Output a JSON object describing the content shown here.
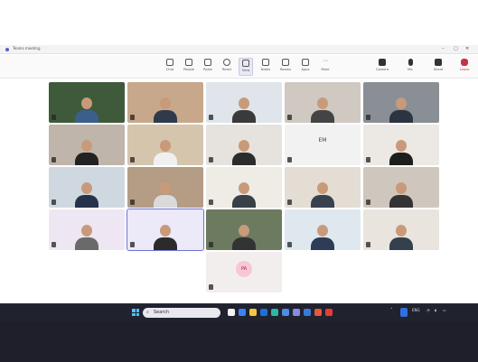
{
  "window": {
    "title": "Teams meeting",
    "center_title": "",
    "controls": [
      "–",
      "▢",
      "✕"
    ]
  },
  "toolbar": {
    "elapsed": "",
    "buttons": [
      {
        "label": "Chat",
        "icon": "chat-icon"
      },
      {
        "label": "People",
        "icon": "people-icon"
      },
      {
        "label": "Raise",
        "icon": "hand-icon"
      },
      {
        "label": "React",
        "icon": "smiley-icon"
      },
      {
        "label": "View",
        "icon": "grid-icon"
      },
      {
        "label": "Notes",
        "icon": "notes-icon"
      },
      {
        "label": "Rooms",
        "icon": "rooms-icon"
      },
      {
        "label": "Apps",
        "icon": "apps-icon"
      },
      {
        "label": "More",
        "icon": "more-icon"
      },
      {
        "label": "Camera",
        "icon": "camera-icon"
      },
      {
        "label": "Mic",
        "icon": "mic-icon"
      },
      {
        "label": "Share",
        "icon": "share-icon"
      },
      {
        "label": "Leave",
        "icon": "phone-icon"
      }
    ]
  },
  "gallery": {
    "participants": [
      {
        "name": "",
        "bg": "#3f5a3a",
        "shirt": "#3b5f8a"
      },
      {
        "name": "",
        "bg": "#c7a88a",
        "shirt": "#2f3a4a"
      },
      {
        "name": "",
        "bg": "#dfe5ea",
        "shirt": "#3a3a3a"
      },
      {
        "name": "",
        "bg": "#cfc9c2",
        "shirt": "#444"
      },
      {
        "name": "",
        "bg": "#8a8f95",
        "shirt": "#2b3440"
      },
      {
        "name": "",
        "bg": "#bfb5aa",
        "shirt": "#222"
      },
      {
        "name": "",
        "bg": "#d6c5ad",
        "shirt": "#f0f0f0"
      },
      {
        "name": "",
        "bg": "#e6e3de",
        "shirt": "#2c2c2c"
      },
      {
        "name": "",
        "bg": "#f2f2f2",
        "initials": "EM"
      },
      {
        "name": "",
        "bg": "#ece8e4",
        "shirt": "#1e1e1e"
      },
      {
        "name": "",
        "bg": "#cfd8e0",
        "shirt": "#26324a"
      },
      {
        "name": "",
        "bg": "#b49c85",
        "shirt": "#dadada"
      },
      {
        "name": "",
        "bg": "#efece6",
        "shirt": "#3a4048"
      },
      {
        "name": "",
        "bg": "#e3ddd4",
        "shirt": "#374150"
      },
      {
        "name": "",
        "bg": "#cfc7bd",
        "shirt": "#333"
      },
      {
        "name": "",
        "bg": "#eee6f2",
        "shirt": "#6a6a6a"
      },
      {
        "name": "",
        "bg": "#ece9f8",
        "shirt": "#2b2b2b"
      },
      {
        "name": "",
        "bg": "#6c7a5f",
        "shirt": "#333"
      },
      {
        "name": "",
        "bg": "#dfe8ef",
        "shirt": "#2d3d55"
      },
      {
        "name": "",
        "bg": "#e9e4de",
        "shirt": "#34404c"
      },
      {
        "name": "",
        "bg": "#f3eeee",
        "initials": "PA"
      }
    ]
  },
  "taskbar": {
    "search_label": "Search",
    "tray_text": "ENG",
    "clock_time": "",
    "clock_date": ""
  }
}
